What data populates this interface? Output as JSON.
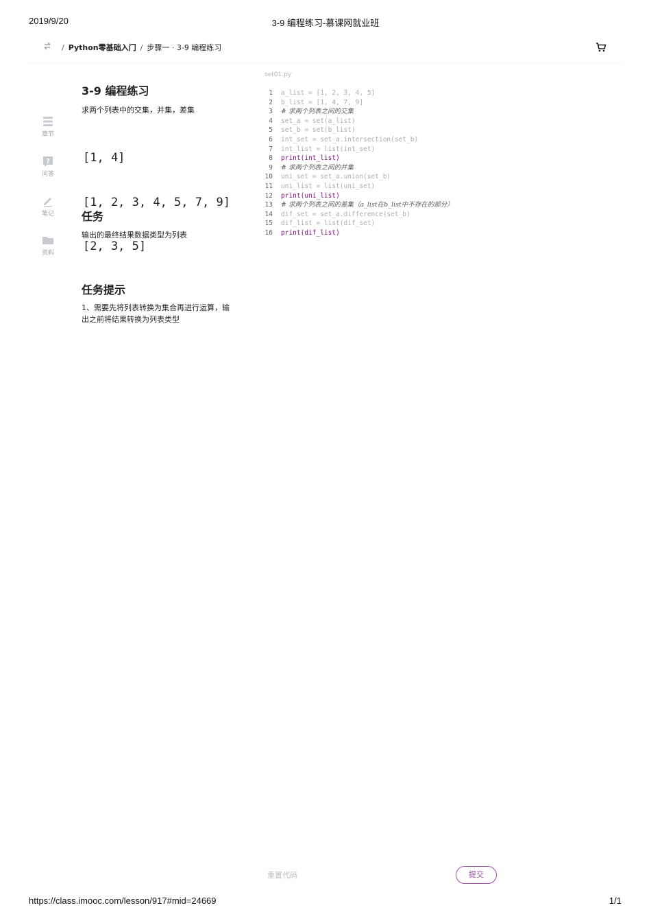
{
  "print": {
    "date": "2019/9/20",
    "title": "3-9 编程练习-慕课网就业班",
    "url": "https://class.imooc.com/lesson/917#mid=24669",
    "page": "1/1"
  },
  "breadcrumb": {
    "sep1": "/",
    "course": "Python零基础入门",
    "sep2": "/",
    "lesson": "步骤一 · 3-9 编程练习"
  },
  "rail": [
    {
      "label": "章节",
      "icon": "list-icon"
    },
    {
      "label": "问答",
      "icon": "question-icon"
    },
    {
      "label": "笔记",
      "icon": "pencil-icon"
    },
    {
      "label": "资料",
      "icon": "folder-icon"
    }
  ],
  "exercise": {
    "title": "3-9 编程练习",
    "description": "求两个列表中的交集，并集，差集",
    "output_lines": [
      "[1, 4]",
      "[1, 2, 3, 4, 5, 7, 9]",
      "[2, 3, 5]"
    ],
    "task_heading": "任务",
    "task_text": "输出的最终结果数据类型为列表",
    "hint_heading": "任务提示",
    "hint_text": "1、需要先将列表转换为集合再进行运算，输出之前将结果转换为列表类型"
  },
  "editor": {
    "filename": "set01.py",
    "lines": [
      {
        "n": "1",
        "text": "a_list = [1, 2, 3, 4, 5]",
        "kind": "code"
      },
      {
        "n": "2",
        "text": "b_list = [1, 4, 7, 9]",
        "kind": "code"
      },
      {
        "n": "3",
        "text": "# 求两个列表之间的交集",
        "kind": "comment"
      },
      {
        "n": "4",
        "text": "set_a = set(a_list)",
        "kind": "code"
      },
      {
        "n": "5",
        "text": "set_b = set(b_list)",
        "kind": "code"
      },
      {
        "n": "6",
        "text": "int_set = set_a.intersection(set_b)",
        "kind": "code"
      },
      {
        "n": "7",
        "text": "int_list = list(int_set)",
        "kind": "code"
      },
      {
        "n": "8",
        "text": "print(int_list)",
        "kind": "kw"
      },
      {
        "n": "9",
        "text": "# 求两个列表之间的并集",
        "kind": "comment"
      },
      {
        "n": "10",
        "text": "uni_set = set_a.union(set_b)",
        "kind": "code"
      },
      {
        "n": "11",
        "text": "uni_list = list(uni_set)",
        "kind": "code"
      },
      {
        "n": "12",
        "text": "print(uni_list)",
        "kind": "kw"
      },
      {
        "n": "13",
        "text": "# 求两个列表之间的差集（a_list在b_list中不存在的部分）",
        "kind": "comment"
      },
      {
        "n": "14",
        "text": "dif_set = set_a.difference(set_b)",
        "kind": "code"
      },
      {
        "n": "15",
        "text": "dif_list = list(dif_set)",
        "kind": "code"
      },
      {
        "n": "16",
        "text": "print(dif_list)",
        "kind": "kw"
      }
    ]
  },
  "actions": {
    "reset": "重置代码",
    "submit": "提交"
  },
  "colors": {
    "accent": "#9b4fa3",
    "keyword": "#7b0d7b"
  }
}
